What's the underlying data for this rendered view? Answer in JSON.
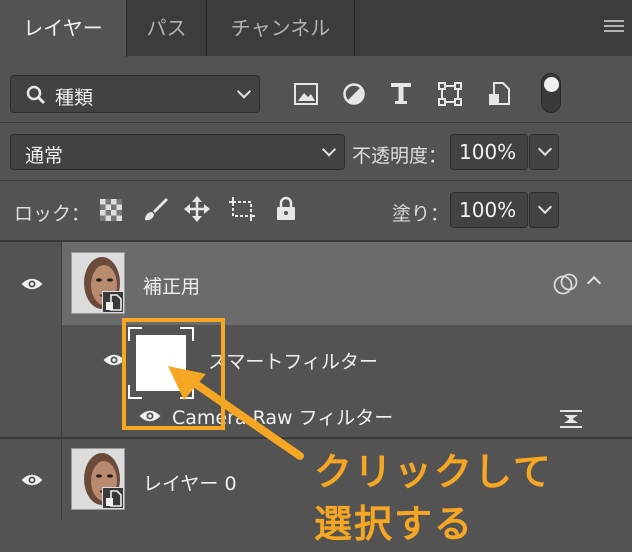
{
  "tabs": [
    {
      "label": "レイヤー",
      "active": true
    },
    {
      "label": "パス",
      "active": false
    },
    {
      "label": "チャンネル",
      "active": false
    }
  ],
  "filter": {
    "kind_label": "種類"
  },
  "blend": {
    "mode": "通常",
    "opacity_label": "不透明度：",
    "opacity_value": "100%"
  },
  "lock": {
    "label": "ロック：",
    "fill_label": "塗り：",
    "fill_value": "100%"
  },
  "layers": {
    "smart": {
      "name": "補正用"
    },
    "smart_filters": {
      "label": "スマートフィルター"
    },
    "filter_item": {
      "label": "Camera Raw フィルター"
    },
    "base": {
      "name": "レイヤー 0"
    }
  },
  "annotation": {
    "line1": "クリックして",
    "line2": "選択する",
    "color": "#f5a623"
  }
}
